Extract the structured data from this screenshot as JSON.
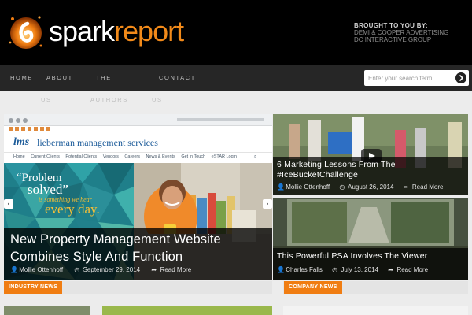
{
  "header": {
    "logo_part1": "spark",
    "logo_part2": "report",
    "sponsor_heading": "BROUGHT TO YOU BY:",
    "sponsor_line1": "DEMI & COOPER ADVERTISING",
    "sponsor_line2": "DC INTERACTIVE GROUP"
  },
  "nav": {
    "items": [
      {
        "line1": "HOME",
        "line2": ""
      },
      {
        "line1": "ABOUT",
        "line2": "US"
      },
      {
        "line1": "THE",
        "line2": "AUTHORS"
      },
      {
        "line1": "CONTACT",
        "line2": "US"
      }
    ],
    "search_placeholder": "Enter your search term..."
  },
  "featured": {
    "screenshot": {
      "brand_abbr": "lms",
      "brand_name": "lieberman management services",
      "menu": [
        "Home",
        "Current Clients",
        "Potential Clients",
        "Vendors",
        "Careers",
        "News & Events",
        "Get in Touch",
        "eSTAR Login"
      ],
      "quote_line1": "“Problem",
      "quote_line2": "solved”",
      "quote_line3": "is something we hear",
      "quote_line4": "every day."
    },
    "title_line1": "New Property Management Website",
    "title_line2": "Combines Style And Function",
    "author": "Mollie Ottenhoff",
    "date": "September 29, 2014",
    "read_more": "Read More"
  },
  "side_posts": [
    {
      "title_line1": "6 Marketing Lessons From The",
      "title_line2": "#IceBucketChallenge",
      "author": "Mollie Ottenhoff",
      "date": "August 26, 2014",
      "read_more": "Read More"
    },
    {
      "title_line1": "This Powerful PSA Involves The Viewer",
      "author": "Charles Falls",
      "date": "July 13, 2014",
      "read_more": "Read More"
    }
  ],
  "sections": {
    "industry_news": "INDUSTRY NEWS",
    "company_news": "COMPANY NEWS"
  },
  "colors": {
    "accent": "#f07d12",
    "header_bg": "#000000",
    "nav_bg": "#262626"
  }
}
